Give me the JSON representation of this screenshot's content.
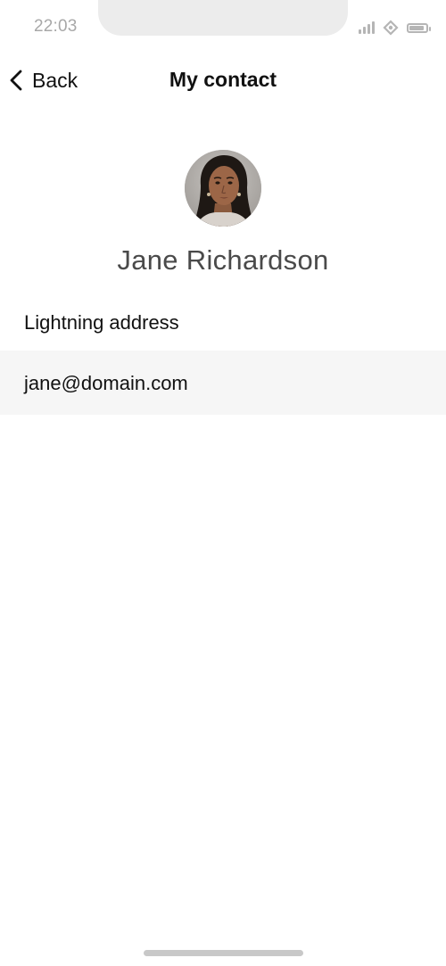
{
  "status_bar": {
    "time": "22:03",
    "icons": [
      "signal-icon",
      "wifi-icon",
      "battery-icon"
    ]
  },
  "nav": {
    "back_label": "Back",
    "title": "My contact",
    "back_icon": "chevron-left-icon"
  },
  "contact": {
    "name": "Jane Richardson",
    "avatar": "avatar-photo"
  },
  "lightning": {
    "label": "Lightning address",
    "value": "jane@domain.com"
  },
  "colors": {
    "background": "#ffffff",
    "row_background": "#f6f6f6",
    "muted_text": "#a8a8a8",
    "name_text": "#4a4a4a"
  }
}
